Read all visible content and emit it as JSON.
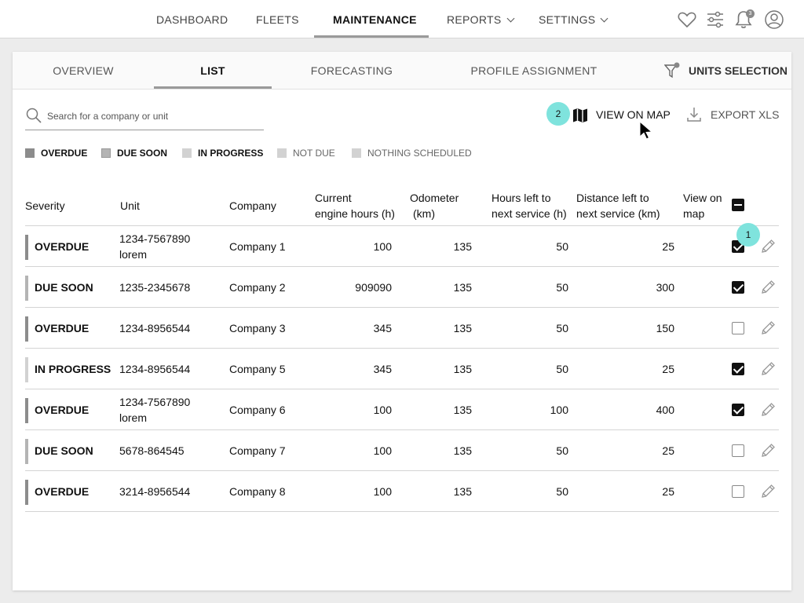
{
  "nav": {
    "items": [
      {
        "label": "DASHBOARD"
      },
      {
        "label": "FLEETS"
      },
      {
        "label": "MAINTENANCE"
      },
      {
        "label": "REPORTS"
      },
      {
        "label": "SETTINGS"
      }
    ],
    "active": "MAINTENANCE",
    "notification_count": "3",
    "icons": [
      "heart-icon",
      "sliders-icon",
      "bell-icon",
      "user-icon"
    ]
  },
  "subtabs": {
    "items": [
      {
        "label": "OVERVIEW"
      },
      {
        "label": "LIST"
      },
      {
        "label": "FORECASTING"
      },
      {
        "label": "PROFILE ASSIGNMENT"
      }
    ],
    "active": "LIST",
    "units_selection": "UNITS SELECTION"
  },
  "toolbar": {
    "search_placeholder": "Search for a company or unit",
    "view_on_map": "VIEW ON MAP",
    "export": "EXPORT XLS",
    "step_badge_view_map": "2",
    "step_badge_row": "1"
  },
  "legend": [
    {
      "label": "OVERDUE",
      "color": "#8c8c8c"
    },
    {
      "label": "DUE SOON",
      "color": "#b4b4b4"
    },
    {
      "label": "IN PROGRESS",
      "color": "#d2d2d2"
    },
    {
      "label": "NOT DUE",
      "color": "#d2d2d2"
    },
    {
      "label": "NOTHING SCHEDULED",
      "color": "#d2d2d2"
    }
  ],
  "table": {
    "headers": {
      "severity": "Severity",
      "unit": "Unit",
      "company": "Company",
      "engine_hours_1": "Current",
      "engine_hours_2": "engine hours (h)",
      "odometer_1": "Odometer",
      "odometer_2": "(km)",
      "hours_left_1": "Hours left to",
      "hours_left_2": "next service (h)",
      "distance_left_1": "Distance left to",
      "distance_left_2": "next service (km)",
      "view_on_map_1": "View on",
      "view_on_map_2": "map"
    },
    "rows": [
      {
        "severity": "OVERDUE",
        "unit_line1": "1234-7567890",
        "unit_line2": "lorem",
        "company": "Company 1",
        "engine_hours": "100",
        "odometer": "135",
        "hours_left": "50",
        "distance_left": "25",
        "view_on_map": true,
        "bar_color": "#8c8c8c"
      },
      {
        "severity": "DUE SOON",
        "unit_line1": "1235-2345678",
        "unit_line2": "",
        "company": "Company 2",
        "engine_hours": "909090",
        "odometer": "135",
        "hours_left": "50",
        "distance_left": "300",
        "view_on_map": true,
        "bar_color": "#b4b4b4"
      },
      {
        "severity": "OVERDUE",
        "unit_line1": "1234-8956544",
        "unit_line2": "",
        "company": "Company 3",
        "engine_hours": "345",
        "odometer": "135",
        "hours_left": "50",
        "distance_left": "150",
        "view_on_map": false,
        "bar_color": "#8c8c8c"
      },
      {
        "severity": "IN PROGRESS",
        "unit_line1": "1234-8956544",
        "unit_line2": "",
        "company": "Company 5",
        "engine_hours": "345",
        "odometer": "135",
        "hours_left": "50",
        "distance_left": "25",
        "view_on_map": true,
        "bar_color": "#d2d2d2"
      },
      {
        "severity": "OVERDUE",
        "unit_line1": "1234-7567890",
        "unit_line2": "lorem",
        "company": "Company 6",
        "engine_hours": "100",
        "odometer": "135",
        "hours_left": "100",
        "distance_left": "400",
        "view_on_map": true,
        "bar_color": "#8c8c8c"
      },
      {
        "severity": "DUE SOON",
        "unit_line1": "5678-864545",
        "unit_line2": "",
        "company": "Company 7",
        "engine_hours": "100",
        "odometer": "135",
        "hours_left": "50",
        "distance_left": "25",
        "view_on_map": false,
        "bar_color": "#b4b4b4"
      },
      {
        "severity": "OVERDUE",
        "unit_line1": "3214-8956544",
        "unit_line2": "",
        "company": "Company 8",
        "engine_hours": "100",
        "odometer": "135",
        "hours_left": "50",
        "distance_left": "25",
        "view_on_map": false,
        "bar_color": "#8c8c8c"
      }
    ]
  },
  "colors": {
    "badge": "#7fe3dd",
    "accent_underline": "#9a9a9a"
  }
}
